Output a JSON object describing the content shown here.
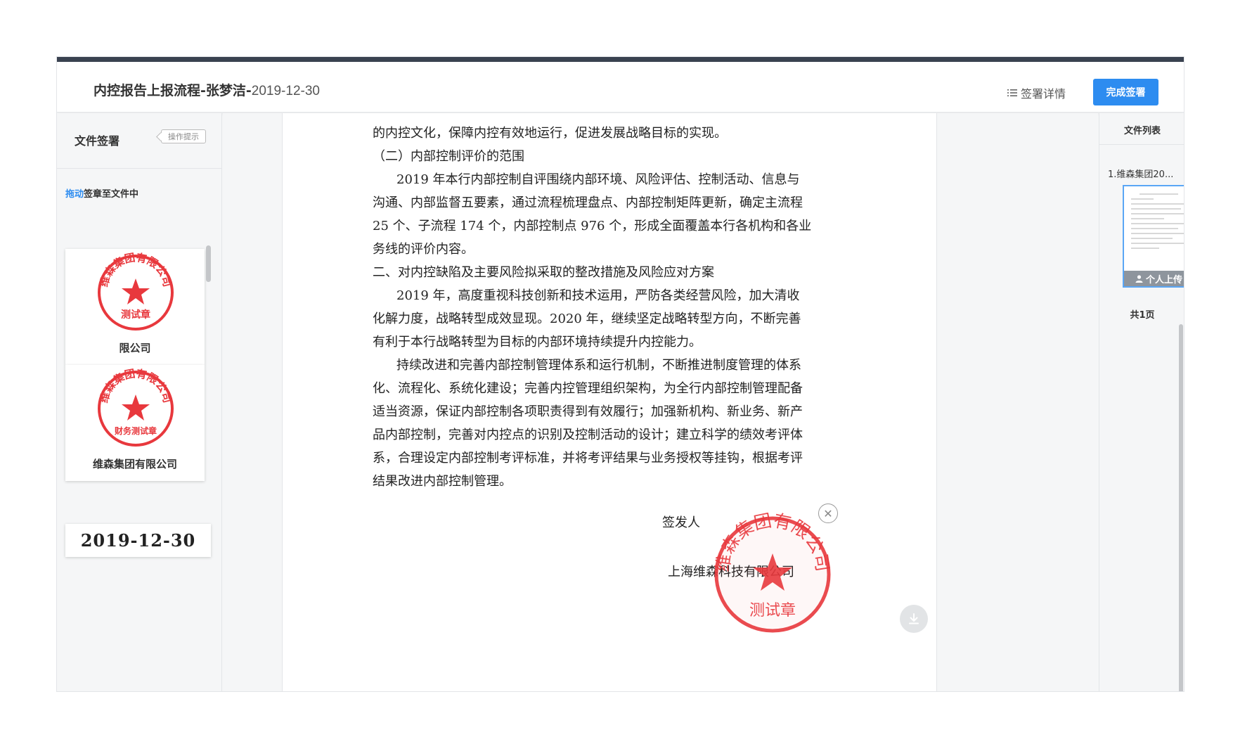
{
  "header": {
    "title_main": "内控报告上报流程-张梦洁-",
    "title_date": "2019-12-30",
    "detail_label": "签署详情",
    "finish_label": "完成签署"
  },
  "left": {
    "title": "文件签署",
    "hint_label": "操作提示",
    "drag_hint_highlight": "拖动",
    "drag_hint_rest": "签章至文件中",
    "seals": [
      {
        "name": "限公司",
        "seal_top_text": "维森集团有限公司",
        "seal_bottom_text": "测试章"
      },
      {
        "name": "维森集团有限公司",
        "seal_top_text": "维森集团有限公司",
        "seal_bottom_text": "财务测试章"
      }
    ],
    "date_stamp": "2019-12-30"
  },
  "document": {
    "lines": [
      "的内控文化，保障内控有效地运行，促进发展战略目标的实现。",
      "（二）内部控制评价的范围",
      "2019 年本行内部控制自评围绕内部环境、风险评估、控制活动、信息与",
      "沟通、内部监督五要素，通过流程梳理盘点、内部控制矩阵更新，确定主流程",
      "25 个、子流程 174 个，内部控制点 976 个，形成全面覆盖本行各机构和各业",
      "务线的评价内容。",
      "二、对内控缺陷及主要风险拟采取的整改措施及风险应对方案",
      "2019 年，高度重视科技创新和技术运用，严防各类经营风险，加大清收",
      "化解力度，战略转型成效显现。2020 年，继续坚定战略转型方向，不断完善",
      "有利于本行战略转型为目标的内部环境持续提升内控能力。",
      "持续改进和完善内部控制管理体系和运行机制，不断推进制度管理的体系",
      "化、流程化、系统化建设；完善内控管理组织架构，为全行内部控制管理配备",
      "适当资源，保证内部控制各项职责得到有效履行；加强新机构、新业务、新产",
      "品内部控制，完善对内控点的识别及控制活动的设计；建立科学的绩效考评体",
      "系，合理设定内部控制考评标准，并将考评结果与业务授权等挂钩，根据考评",
      "结果改进内部控制管理。"
    ],
    "signer_label": "签发人",
    "company": "上海维森科技有限公司",
    "placed_seal_top_text": "维森集团有限公司",
    "placed_seal_bottom_text": "测试章"
  },
  "right": {
    "title": "文件列表",
    "file_name": "1.维森集团20...",
    "badge": "个人上传",
    "page_count": "共1页"
  },
  "colors": {
    "primary": "#2d8cf0",
    "seal_red": "#e8383d",
    "topbar": "#3a4250"
  }
}
